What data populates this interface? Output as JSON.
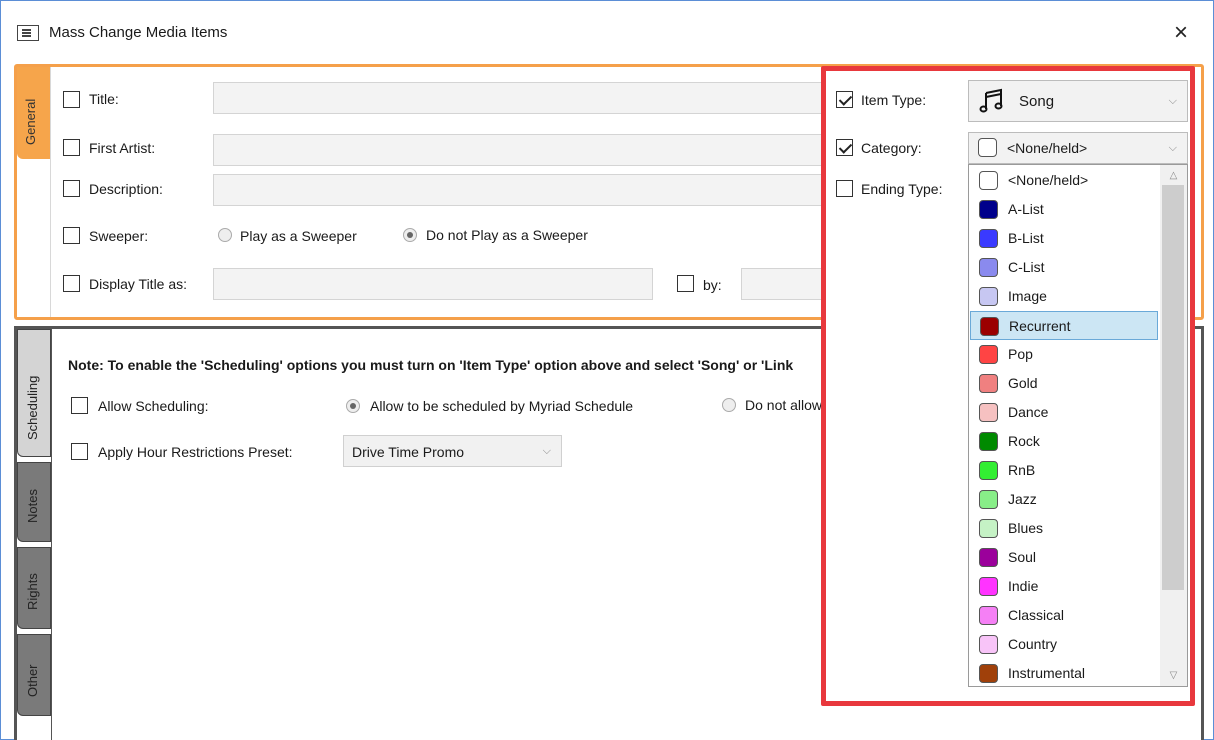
{
  "window": {
    "title": "Mass Change Media Items",
    "close": "×"
  },
  "general": {
    "tab_label": "General",
    "title_label": "Title:",
    "first_artist_label": "First Artist:",
    "description_label": "Description:",
    "sweeper_label": "Sweeper:",
    "sweeper_opt1": "Play as a Sweeper",
    "sweeper_opt2": "Do not Play as a Sweeper",
    "display_title_label": "Display Title as:",
    "by_label": "by:",
    "item_type_label": "Item Type:",
    "item_type_value": "Song",
    "category_label": "Category:",
    "category_value": "<None/held>",
    "ending_type_label": "Ending Type:"
  },
  "tabs": {
    "scheduling": "Scheduling",
    "notes": "Notes",
    "rights": "Rights",
    "other": "Other"
  },
  "scheduling": {
    "note": "Note: To enable the 'Scheduling' options you must turn on 'Item Type' option above and select 'Song' or 'Link",
    "allow_label": "Allow Scheduling:",
    "allow_opt1": "Allow to be scheduled by Myriad Schedule",
    "allow_opt2": "Do not allow scheduling",
    "hour_label": "Apply Hour Restrictions Preset:",
    "hour_value": "Drive Time Promo"
  },
  "category_options": [
    {
      "label": "<None/held>",
      "color": "#ffffff"
    },
    {
      "label": "A-List",
      "color": "#00008b"
    },
    {
      "label": "B-List",
      "color": "#3a3aff"
    },
    {
      "label": "C-List",
      "color": "#8a8aee"
    },
    {
      "label": "Image",
      "color": "#c7c7f2"
    },
    {
      "label": "Recurrent",
      "color": "#9b0000"
    },
    {
      "label": "Pop",
      "color": "#ff4444"
    },
    {
      "label": "Gold",
      "color": "#f08080"
    },
    {
      "label": "Dance",
      "color": "#f6c1c1"
    },
    {
      "label": "Rock",
      "color": "#008a00"
    },
    {
      "label": "RnB",
      "color": "#33ee33"
    },
    {
      "label": "Jazz",
      "color": "#88ee88"
    },
    {
      "label": "Blues",
      "color": "#c5f2c5"
    },
    {
      "label": "Soul",
      "color": "#9b009b"
    },
    {
      "label": "Indie",
      "color": "#ff33ff"
    },
    {
      "label": "Classical",
      "color": "#f580f5"
    },
    {
      "label": "Country",
      "color": "#f8c4f8"
    },
    {
      "label": "Instrumental",
      "color": "#a0400a"
    }
  ],
  "selected_option": "Recurrent",
  "icons": {
    "window": "window-icon",
    "song": "music-note-icon"
  }
}
